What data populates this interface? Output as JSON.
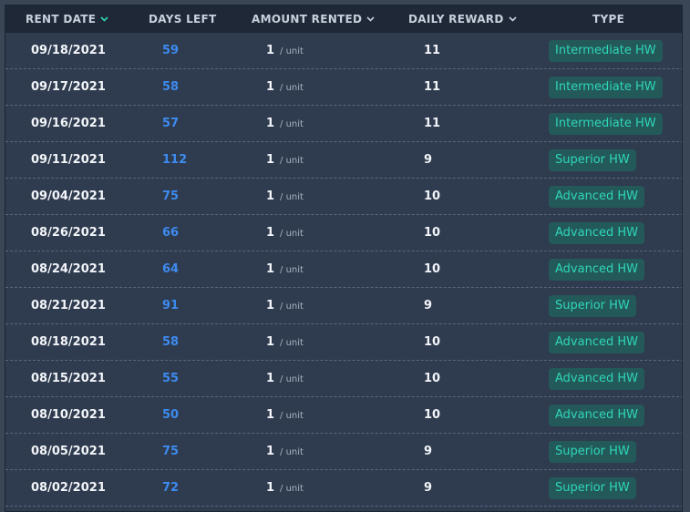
{
  "table": {
    "columns": [
      {
        "label": "RENT DATE",
        "sort": "active"
      },
      {
        "label": "DAYS LEFT",
        "sort": "none"
      },
      {
        "label": "AMOUNT RENTED",
        "sort": "available"
      },
      {
        "label": "DAILY REWARD",
        "sort": "available"
      },
      {
        "label": "TYPE",
        "sort": "none"
      }
    ],
    "unit_suffix": "/ unit",
    "rows": [
      {
        "date": "09/18/2021",
        "days_left": "59",
        "amount": "1",
        "reward": "11",
        "type": "Intermediate HW"
      },
      {
        "date": "09/17/2021",
        "days_left": "58",
        "amount": "1",
        "reward": "11",
        "type": "Intermediate HW"
      },
      {
        "date": "09/16/2021",
        "days_left": "57",
        "amount": "1",
        "reward": "11",
        "type": "Intermediate HW"
      },
      {
        "date": "09/11/2021",
        "days_left": "112",
        "amount": "1",
        "reward": "9",
        "type": "Superior HW"
      },
      {
        "date": "09/04/2021",
        "days_left": "75",
        "amount": "1",
        "reward": "10",
        "type": "Advanced HW"
      },
      {
        "date": "08/26/2021",
        "days_left": "66",
        "amount": "1",
        "reward": "10",
        "type": "Advanced HW"
      },
      {
        "date": "08/24/2021",
        "days_left": "64",
        "amount": "1",
        "reward": "10",
        "type": "Advanced HW"
      },
      {
        "date": "08/21/2021",
        "days_left": "91",
        "amount": "1",
        "reward": "9",
        "type": "Superior HW"
      },
      {
        "date": "08/18/2021",
        "days_left": "58",
        "amount": "1",
        "reward": "10",
        "type": "Advanced HW"
      },
      {
        "date": "08/15/2021",
        "days_left": "55",
        "amount": "1",
        "reward": "10",
        "type": "Advanced HW"
      },
      {
        "date": "08/10/2021",
        "days_left": "50",
        "amount": "1",
        "reward": "10",
        "type": "Advanced HW"
      },
      {
        "date": "08/05/2021",
        "days_left": "75",
        "amount": "1",
        "reward": "9",
        "type": "Superior HW"
      },
      {
        "date": "08/02/2021",
        "days_left": "72",
        "amount": "1",
        "reward": "9",
        "type": "Superior HW"
      }
    ]
  },
  "colors": {
    "background": "#2f3b4e",
    "header": "#1f2836",
    "days_left": "#3d8bf0",
    "badge_text": "#2ed6b8",
    "badge_bg": "#24595a",
    "active_sort": "#2ed6b8"
  },
  "icons": {
    "sort": "chevron-down-icon"
  }
}
